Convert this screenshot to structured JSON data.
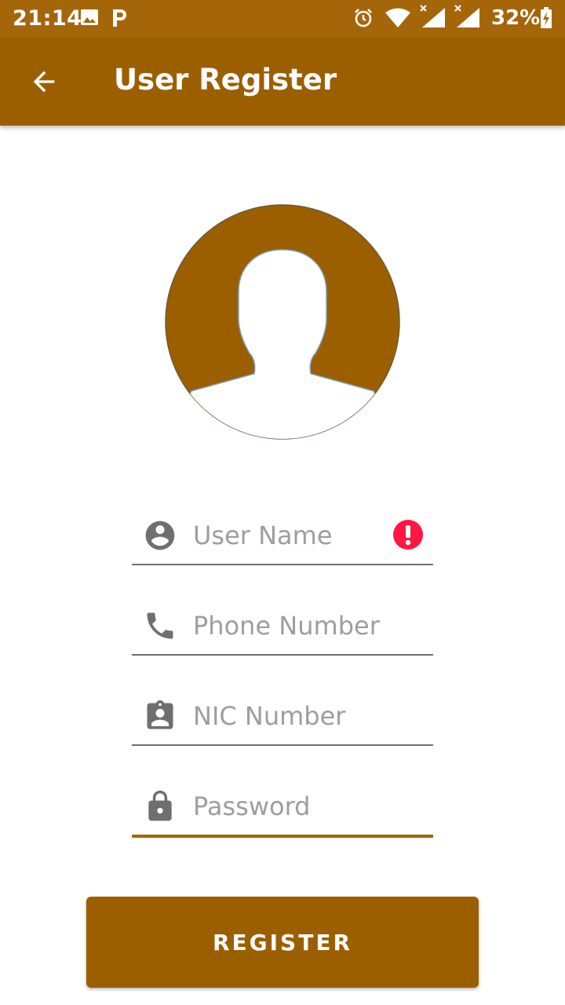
{
  "status_bar": {
    "time": "21:14",
    "battery": "32%",
    "icons": [
      "image-icon",
      "p-app-icon",
      "alarm-icon",
      "wifi-icon",
      "signal-icon",
      "signal-icon",
      "battery-charging-icon"
    ]
  },
  "app_bar": {
    "title": "User Register",
    "back_icon": "arrow-back-icon",
    "color": "#9c5f00"
  },
  "avatar": {
    "icon": "person-avatar-icon",
    "color": "#9c5f00"
  },
  "form": {
    "username": {
      "placeholder": "User Name",
      "icon": "account-circle-icon",
      "error_icon": "error-icon"
    },
    "phone": {
      "placeholder": "Phone Number",
      "icon": "phone-icon"
    },
    "nic": {
      "placeholder": "NIC Number",
      "icon": "badge-icon"
    },
    "password": {
      "placeholder": "Password",
      "icon": "lock-icon"
    }
  },
  "register_button": {
    "label": "REGISTER"
  },
  "colors": {
    "status_bar": "#a5660a",
    "accent": "#9c5f00",
    "error": "#ff1744",
    "icon_gray": "#6f6f6f"
  }
}
